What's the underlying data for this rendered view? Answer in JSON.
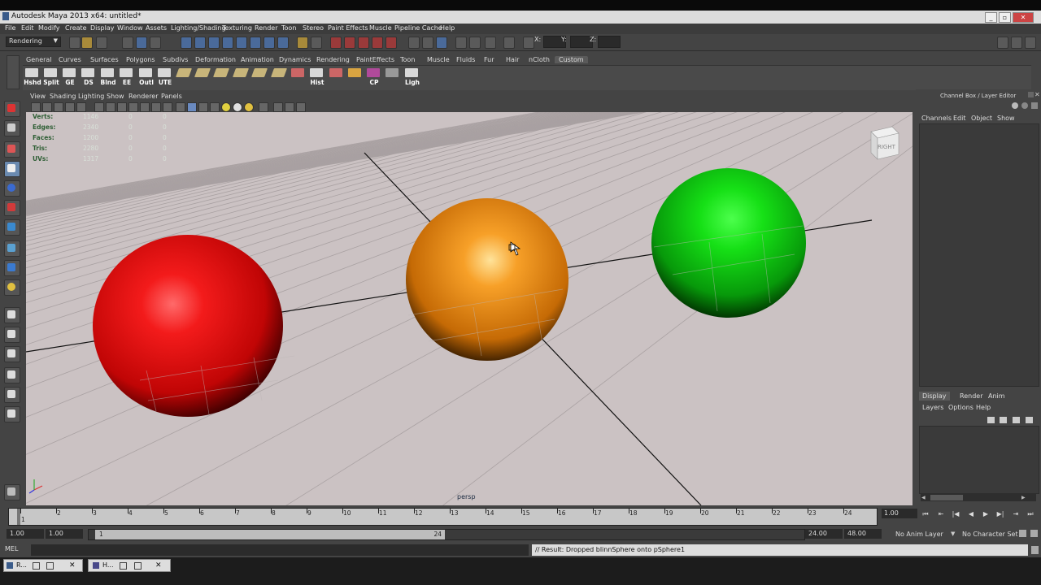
{
  "window": {
    "title": "Autodesk Maya 2013 x64: untitled*"
  },
  "menus": [
    "File",
    "Edit",
    "Modify",
    "Create",
    "Display",
    "Window",
    "Assets",
    "Lighting/Shading",
    "Texturing",
    "Render",
    "Toon",
    "Stereo",
    "Paint Effects",
    "Muscle",
    "Pipeline Cache",
    "Help"
  ],
  "status_line": {
    "mode": "Rendering",
    "x_label": "X:",
    "y_label": "Y:",
    "z_label": "Z:"
  },
  "shelf_tabs": [
    "General",
    "Curves",
    "Surfaces",
    "Polygons",
    "Subdivs",
    "Deformation",
    "Animation",
    "Dynamics",
    "Rendering",
    "PaintEffects",
    "Toon",
    "Muscle",
    "Fluids",
    "Fur",
    "Hair",
    "nCloth",
    "Custom"
  ],
  "shelf_active": "Custom",
  "shelf_items": [
    "Hshd",
    "Split",
    "GE",
    "DS",
    "Blnd",
    "EE",
    "Outl",
    "UTE",
    "",
    "",
    "",
    "",
    "",
    "",
    "Hist",
    "",
    "",
    "CP",
    "",
    "Ligh"
  ],
  "panel_menu": [
    "View",
    "Shading",
    "Lighting",
    "Show",
    "Renderer",
    "Panels"
  ],
  "hud": [
    {
      "label": "Verts:",
      "values": [
        "1146",
        "0",
        "0"
      ]
    },
    {
      "label": "Edges:",
      "values": [
        "2340",
        "0",
        "0"
      ]
    },
    {
      "label": "Faces:",
      "values": [
        "1200",
        "0",
        "0"
      ]
    },
    {
      "label": "Tris:",
      "values": [
        "2280",
        "0",
        "0"
      ]
    },
    {
      "label": "UVs:",
      "values": [
        "1317",
        "0",
        "0"
      ]
    }
  ],
  "viewcube_label": "RIGHT",
  "camera_label": "persp",
  "right_panel": {
    "title": "Channel Box / Layer Editor",
    "channel_menu": [
      "Channels",
      "Edit",
      "Object",
      "Show"
    ],
    "layer_tabs": [
      "Display",
      "Render",
      "Anim"
    ],
    "layer_menu": [
      "Layers",
      "Options",
      "Help"
    ]
  },
  "timeline": {
    "ticks": [
      "1",
      "2",
      "3",
      "4",
      "5",
      "6",
      "7",
      "8",
      "9",
      "10",
      "11",
      "12",
      "13",
      "14",
      "15",
      "16",
      "17",
      "18",
      "19",
      "20",
      "21",
      "22",
      "23",
      "24"
    ],
    "current_frame": "1.00"
  },
  "range": {
    "start": "1.00",
    "playback_start": "1.00",
    "range_knob_start": "1",
    "range_knob_end": "24",
    "playback_end": "24.00",
    "end": "48.00",
    "anim_layer": "No Anim Layer",
    "character_set": "No Character Set"
  },
  "command": {
    "lang": "MEL",
    "result": "// Result: Dropped blinnSphere onto pSphere1"
  },
  "taskbar": [
    {
      "label": "R..."
    },
    {
      "label": "H..."
    }
  ],
  "colors": {
    "viewport_bg": "#cbc2c3",
    "grid": "#a9a1a2",
    "red_sphere": "#e01010",
    "orange_sphere": "#f29a1a",
    "green_sphere": "#18d018"
  }
}
